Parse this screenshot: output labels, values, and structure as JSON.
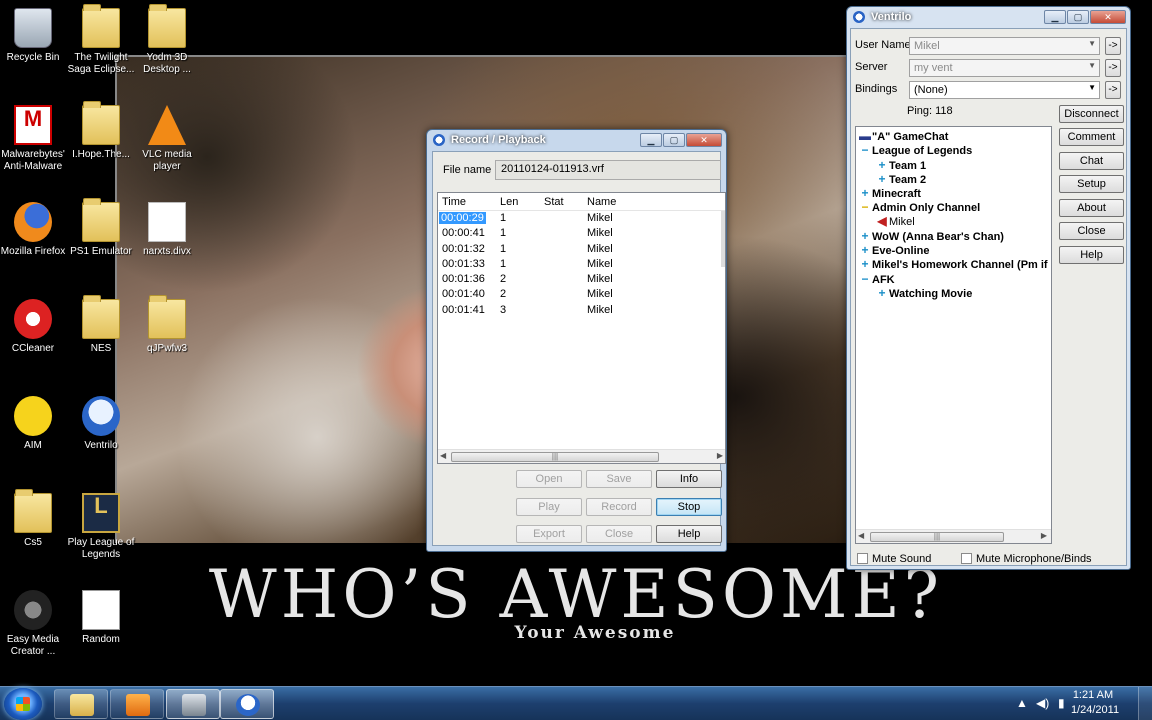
{
  "desktop": {
    "wallpaper": {
      "motto": "WHO’S AWESOME?",
      "submotto": "Your Awesome"
    },
    "icons": [
      {
        "label": "Recycle Bin",
        "icon": "recycle-bin-icon"
      },
      {
        "label": "The Twilight Saga Eclipse...",
        "icon": "folder-icon"
      },
      {
        "label": "Yodm 3D Desktop ...",
        "icon": "folder-icon"
      },
      {
        "label": "Malwarebytes' Anti-Malware",
        "icon": "malwarebytes-icon"
      },
      {
        "label": "I.Hope.The...",
        "icon": "folder-icon"
      },
      {
        "label": "VLC media player",
        "icon": "vlc-icon"
      },
      {
        "label": "Mozilla Firefox",
        "icon": "firefox-icon"
      },
      {
        "label": "PS1 Emulator",
        "icon": "folder-icon"
      },
      {
        "label": "narxts.divx",
        "icon": "file-icon"
      },
      {
        "label": "CCleaner",
        "icon": "ccleaner-icon"
      },
      {
        "label": "NES",
        "icon": "folder-icon"
      },
      {
        "label": "qJPwfw3",
        "icon": "folder-icon"
      },
      {
        "label": "AIM",
        "icon": "aim-icon"
      },
      {
        "label": "Ventrilo",
        "icon": "ventrilo-icon"
      },
      {
        "label": "Cs5",
        "icon": "folder-icon"
      },
      {
        "label": "Play League of Legends",
        "icon": "league-of-legends-icon"
      },
      {
        "label": "Easy Media Creator ...",
        "icon": "easy-media-creator-icon"
      },
      {
        "label": "Random",
        "icon": "file-icon"
      }
    ]
  },
  "record_playback": {
    "title": "Record / Playback",
    "file_name_label": "File name",
    "file_name_value": "20110124-011913.vrf",
    "columns": [
      "Time",
      "Len",
      "Stat",
      "Name"
    ],
    "rows": [
      {
        "time": "00:00:29",
        "len": "1",
        "stat": "",
        "name": "Mikel"
      },
      {
        "time": "00:00:41",
        "len": "1",
        "stat": "",
        "name": "Mikel"
      },
      {
        "time": "00:01:32",
        "len": "1",
        "stat": "",
        "name": "Mikel"
      },
      {
        "time": "00:01:33",
        "len": "1",
        "stat": "",
        "name": "Mikel"
      },
      {
        "time": "00:01:36",
        "len": "2",
        "stat": "",
        "name": "Mikel"
      },
      {
        "time": "00:01:40",
        "len": "2",
        "stat": "",
        "name": "Mikel"
      },
      {
        "time": "00:01:41",
        "len": "3",
        "stat": "",
        "name": "Mikel"
      }
    ],
    "buttons": {
      "open": "Open",
      "save": "Save",
      "info": "Info",
      "play": "Play",
      "record": "Record",
      "stop": "Stop",
      "export": "Export",
      "close": "Close",
      "help": "Help"
    }
  },
  "ventrilo": {
    "title": "Ventrilo",
    "user_name_label": "User Name",
    "user_name_value": "Mikel",
    "server_label": "Server",
    "server_value": "my vent",
    "bindings_label": "Bindings",
    "bindings_value": "(None)",
    "ping": "Ping: 118",
    "buttons": {
      "disconnect": "Disconnect",
      "comment": "Comment",
      "chat": "Chat",
      "setup": "Setup",
      "about": "About",
      "close": "Close",
      "help": "Help"
    },
    "tree": [
      {
        "label": "\"A\" GameChat",
        "kind": "server"
      },
      {
        "label": "League of Legends",
        "kind": "channel-open"
      },
      {
        "label": "Team 1",
        "kind": "subchannel"
      },
      {
        "label": "Team 2",
        "kind": "subchannel"
      },
      {
        "label": "Minecraft",
        "kind": "channel"
      },
      {
        "label": "Admin Only Channel",
        "kind": "channel-open-admin"
      },
      {
        "label": "Mikel",
        "kind": "user"
      },
      {
        "label": "WoW (Anna Bear's Chan)",
        "kind": "channel"
      },
      {
        "label": "Eve-Online",
        "kind": "channel"
      },
      {
        "label": "Mikel's Homework Channel (Pm if",
        "kind": "channel"
      },
      {
        "label": "AFK",
        "kind": "channel-open"
      },
      {
        "label": "Watching Movie",
        "kind": "subchannel"
      }
    ],
    "mute_sound": "Mute Sound",
    "mute_mic": "Mute Microphone/Binds"
  },
  "taskbar": {
    "time": "1:21 AM",
    "date": "1/24/2011"
  }
}
